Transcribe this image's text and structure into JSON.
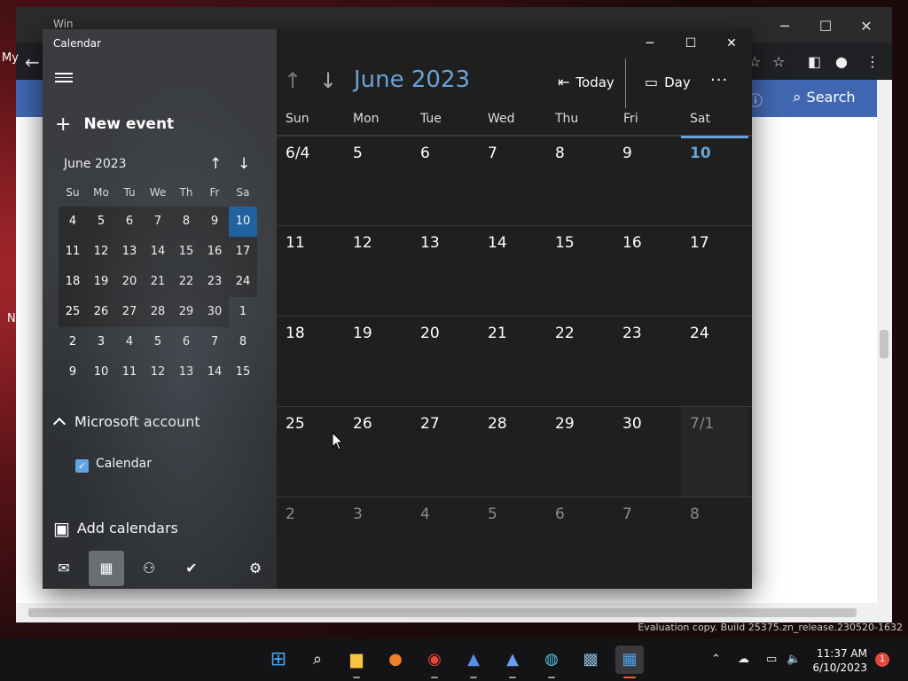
{
  "browser": {
    "tab_title": "Win",
    "bookmark_label": "My",
    "search_label": "Search",
    "left_letter": "N"
  },
  "app": {
    "title": "Calendar"
  },
  "sidebar": {
    "new_event": "New event",
    "mini": {
      "title": "June 2023",
      "dow": [
        "Su",
        "Mo",
        "Tu",
        "We",
        "Th",
        "Fr",
        "Sa"
      ],
      "weeks": [
        [
          "4",
          "5",
          "6",
          "7",
          "8",
          "9",
          "10"
        ],
        [
          "11",
          "12",
          "13",
          "14",
          "15",
          "16",
          "17"
        ],
        [
          "18",
          "19",
          "20",
          "21",
          "22",
          "23",
          "24"
        ],
        [
          "25",
          "26",
          "27",
          "28",
          "29",
          "30",
          "1"
        ],
        [
          "2",
          "3",
          "4",
          "5",
          "6",
          "7",
          "8"
        ],
        [
          "9",
          "10",
          "11",
          "12",
          "13",
          "14",
          "15"
        ]
      ]
    },
    "account": "Microsoft account",
    "calendar_item": "Calendar",
    "add_calendars": "Add calendars"
  },
  "main": {
    "month_title": "June 2023",
    "today_label": "Today",
    "view_label": "Day",
    "dow": [
      "Sun",
      "Mon",
      "Tue",
      "Wed",
      "Thu",
      "Fri",
      "Sat"
    ],
    "weeks": [
      [
        "6/4",
        "5",
        "6",
        "7",
        "8",
        "9",
        "10"
      ],
      [
        "11",
        "12",
        "13",
        "14",
        "15",
        "16",
        "17"
      ],
      [
        "18",
        "19",
        "20",
        "21",
        "22",
        "23",
        "24"
      ],
      [
        "25",
        "26",
        "27",
        "28",
        "29",
        "30",
        "7/1"
      ],
      [
        "2",
        "3",
        "4",
        "5",
        "6",
        "7",
        "8"
      ]
    ]
  },
  "taskbar": {
    "time": "11:37 AM",
    "date": "6/10/2023",
    "notifications": "1",
    "eval_text": "Evaluation copy. Build 25375.zn_release.230520-1632"
  },
  "colors": {
    "accent": "#6aa1d8",
    "selected_day": "#1b5fa0",
    "browser_bar": "#4267b2"
  }
}
